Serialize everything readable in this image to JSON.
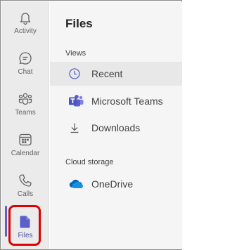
{
  "rail": {
    "items": [
      {
        "label": "Activity",
        "icon": "bell-icon"
      },
      {
        "label": "Chat",
        "icon": "chat-icon"
      },
      {
        "label": "Teams",
        "icon": "teams-icon"
      },
      {
        "label": "Calendar",
        "icon": "calendar-icon"
      },
      {
        "label": "Calls",
        "icon": "phone-icon"
      },
      {
        "label": "Files",
        "icon": "file-icon"
      }
    ],
    "active": "Files",
    "accent": "#5b5fc7",
    "callout_color": "#e00000"
  },
  "pane": {
    "title": "Files",
    "views_label": "Views",
    "views": [
      {
        "label": "Recent",
        "icon": "clock-icon"
      },
      {
        "label": "Microsoft Teams",
        "icon": "teams-logo-icon"
      },
      {
        "label": "Downloads",
        "icon": "download-icon"
      }
    ],
    "cloud_label": "Cloud storage",
    "cloud": [
      {
        "label": "OneDrive",
        "icon": "onedrive-icon"
      }
    ]
  }
}
